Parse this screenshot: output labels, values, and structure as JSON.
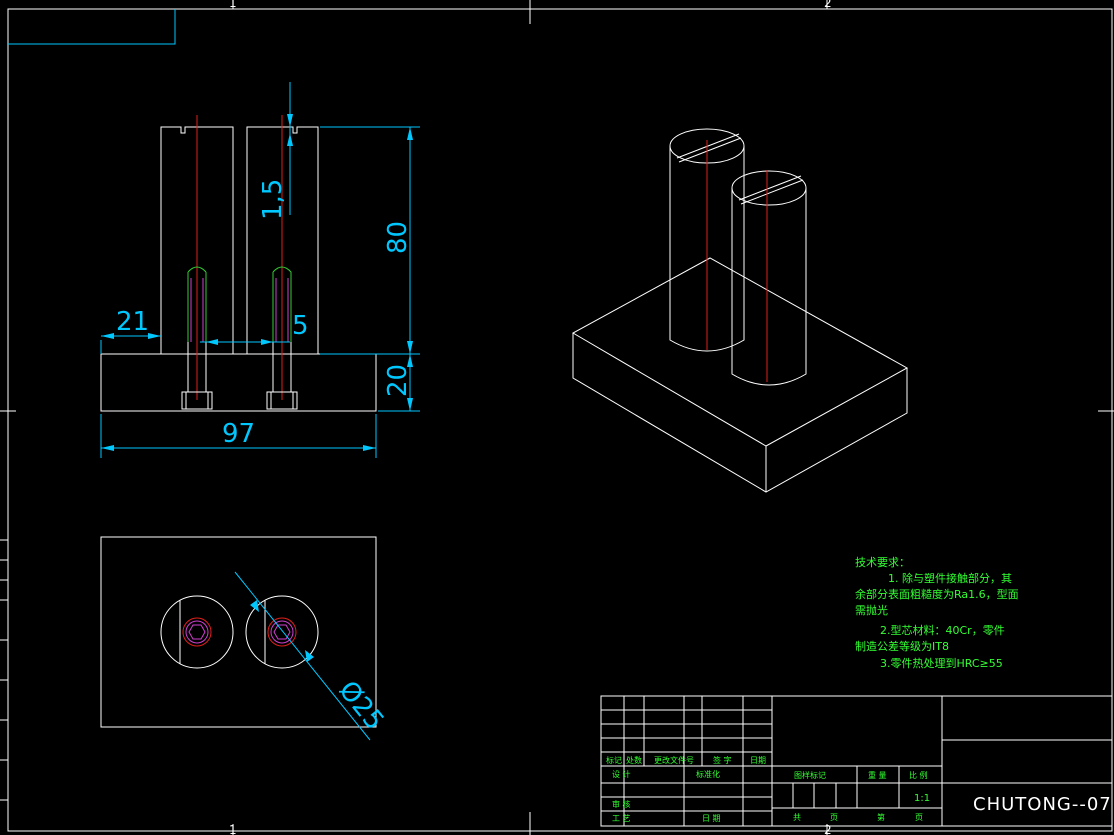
{
  "drawing": {
    "number": "CHUTONG--07",
    "zones": {
      "top_1": "1",
      "top_2": "2",
      "bottom_1": "1",
      "bottom_2": "2"
    },
    "colors": {
      "background": "#000000",
      "outline": "#ffffff",
      "dimension": "#00c8ff",
      "centerline": "#e0201a",
      "notes": "#33ff33",
      "thread": "#d040d0"
    }
  },
  "dimensions": {
    "width": "97",
    "left_offset": "21",
    "gap": "5",
    "pin_height": "80",
    "base_height": "20",
    "slot_depth": "1,5",
    "diameter": "Ø25"
  },
  "notes": {
    "title": "技术要求：",
    "line1": "1. 除与塑件接触部分，其",
    "line2": "余部分表面粗糙度为Ra1.6，型面",
    "line3": "需抛光",
    "line4": "2.型芯材料：40Cr，零件",
    "line5": "制造公差等级为IT8",
    "line6": "3.零件热处理到HRC≥55"
  },
  "title_block": {
    "mark": "标记",
    "count": "处数",
    "change_doc": "更改文件号",
    "sign": "签 字",
    "date": "日期",
    "design": "设 计",
    "standardize": "标准化",
    "review": "审 核",
    "process": "工 艺",
    "date2": "日 期",
    "stage_mark": "图样标记",
    "weight": "重 量",
    "scale": "比 例",
    "scale_value": "1:1",
    "total": "共",
    "sheets": "页",
    "sheet_no": "第",
    "page": "页"
  }
}
